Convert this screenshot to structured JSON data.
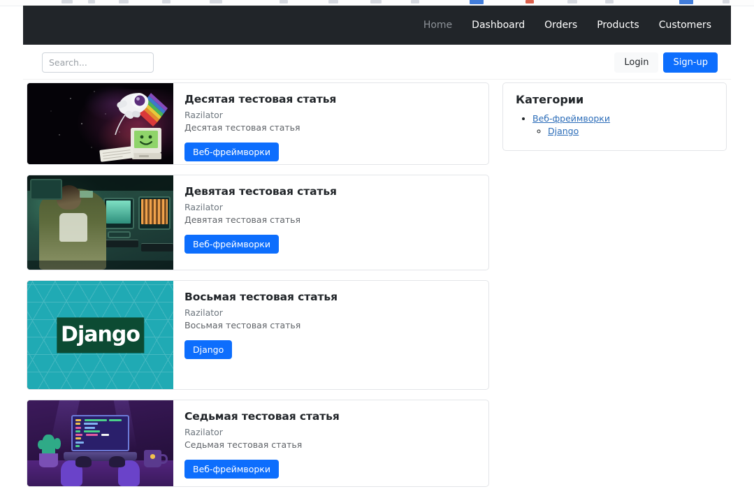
{
  "navbar": {
    "links": [
      {
        "label": "Home",
        "active": true
      },
      {
        "label": "Dashboard",
        "active": false
      },
      {
        "label": "Orders",
        "active": false
      },
      {
        "label": "Products",
        "active": false
      },
      {
        "label": "Customers",
        "active": false
      }
    ]
  },
  "subbar": {
    "search_placeholder": "Search...",
    "search_value": "",
    "login_label": "Login",
    "signup_label": "Sign-up"
  },
  "articles": [
    {
      "title": "Десятая тестовая статья",
      "author": "Razilator",
      "excerpt": "Десятая тестовая статья",
      "tag": "Веб-фреймворки",
      "image": "astronaut-space-computer"
    },
    {
      "title": "Девятая тестовая статья",
      "author": "Razilator",
      "excerpt": "Девятая тестовая статья",
      "tag": "Веб-фреймворки",
      "image": "retro-computer-desk-photo"
    },
    {
      "title": "Восьмая тестовая статья",
      "author": "Razilator",
      "excerpt": "Восьмая тестовая статья",
      "tag": "Django",
      "image": "django-logo"
    },
    {
      "title": "Седьмая тестовая статья",
      "author": "Razilator",
      "excerpt": "Седьмая тестовая статья",
      "tag": "Веб-фреймворки",
      "image": "purple-laptop-coding"
    }
  ],
  "sidebar": {
    "title": "Категории",
    "categories": [
      {
        "label": "Веб-фреймворки",
        "children": [
          {
            "label": "Django"
          }
        ]
      }
    ]
  },
  "colors": {
    "navbar_bg": "#212529",
    "primary": "#0d6efd",
    "link": "#2b6cb8",
    "muted_text": "#6c757d",
    "card_border": "#e3e5e8",
    "django_teal": "#20aab4",
    "django_green": "#0c4b33"
  }
}
